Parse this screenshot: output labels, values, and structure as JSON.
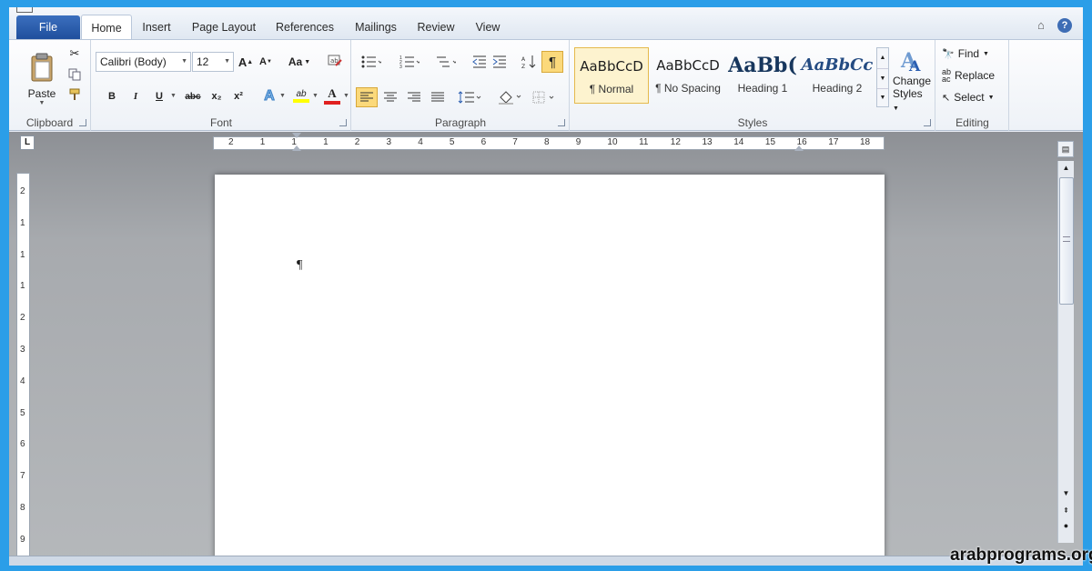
{
  "tabs": {
    "file": "File",
    "home": "Home",
    "insert": "Insert",
    "page_layout": "Page Layout",
    "references": "References",
    "mailings": "Mailings",
    "review": "Review",
    "view": "View"
  },
  "help_label": "?",
  "clipboard": {
    "paste": "Paste",
    "label": "Clipboard"
  },
  "font": {
    "name": "Calibri (Body)",
    "size": "12",
    "case_label": "Aa",
    "strike_label": "abc",
    "sub_label": "x₂",
    "sup_label": "x²",
    "bold": "B",
    "italic": "I",
    "underline": "U",
    "highlight_label": "ab",
    "color_label": "A",
    "label": "Font"
  },
  "paragraph": {
    "label": "Paragraph",
    "show_marks": "¶"
  },
  "styles": {
    "label": "Styles",
    "items": [
      {
        "preview": "AaBbCcD",
        "name": "¶ Normal"
      },
      {
        "preview": "AaBbCcD",
        "name": "¶ No Spacing"
      },
      {
        "preview": "AaBb(",
        "name": "Heading 1"
      },
      {
        "preview": "AaBbCc",
        "name": "Heading 2"
      }
    ],
    "change_line1": "Change",
    "change_line2": "Styles"
  },
  "editing": {
    "find": "Find",
    "replace": "Replace",
    "select": "Select",
    "label": "Editing"
  },
  "ruler": {
    "h_numbers": [
      "2",
      "1",
      "1",
      "1",
      "2",
      "3",
      "4",
      "5",
      "6",
      "7",
      "8",
      "9",
      "10",
      "11",
      "12",
      "13",
      "14",
      "15",
      "16",
      "17",
      "18"
    ],
    "v_numbers": [
      "2",
      "1",
      "1",
      "1",
      "2",
      "3",
      "4",
      "5",
      "6",
      "7",
      "8",
      "9"
    ]
  },
  "document": {
    "paragraph_mark": "¶"
  },
  "colors": {
    "file_tab": "#2b5aa8",
    "highlight": "#ffff00",
    "font_color": "#e02020",
    "accent_active": "#fbd97b",
    "background": "#2b9ee8"
  },
  "watermark": "arabprograms.org"
}
